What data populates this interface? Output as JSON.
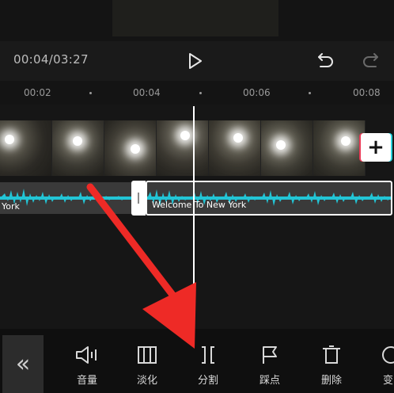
{
  "player": {
    "timecode": "00:04/03:27"
  },
  "ruler": {
    "ticks": [
      "00:02",
      "00:04",
      "00:06",
      "00:08"
    ]
  },
  "audio": {
    "left_clip_label": "York",
    "right_clip_label": "Welcome To New York"
  },
  "toolbar": {
    "tools": [
      {
        "label": "音量",
        "icon": "speaker-icon"
      },
      {
        "label": "淡化",
        "icon": "fade-icon"
      },
      {
        "label": "分割",
        "icon": "split-icon"
      },
      {
        "label": "踩点",
        "icon": "flag-icon"
      },
      {
        "label": "删除",
        "icon": "trash-icon"
      },
      {
        "label": "变",
        "icon": "speed-icon"
      }
    ]
  },
  "colors": {
    "accent_waveform": "#22c5d6",
    "annotation_arrow": "#ee2a26",
    "track_background": "#3a3a3a"
  }
}
